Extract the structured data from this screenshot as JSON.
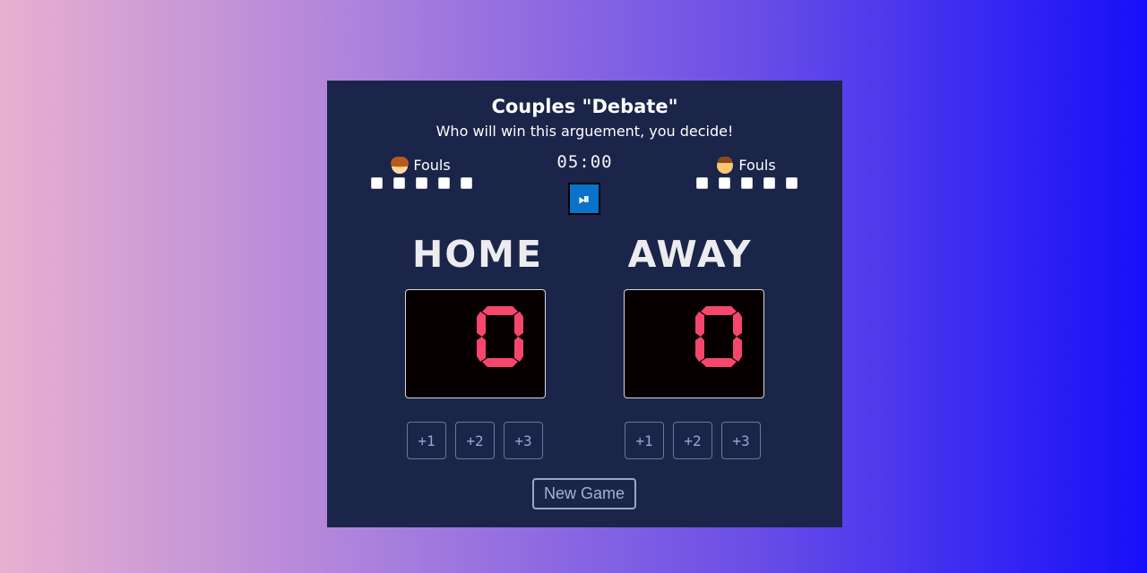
{
  "title": "Couples \"Debate\"",
  "subtitle": "Who will win this arguement, you decide!",
  "timer": "05:00",
  "play_pause_label": "⏯",
  "home": {
    "fouls_label": "Fouls",
    "avatar_icon": "woman-emoji-icon",
    "fouls": [
      false,
      false,
      false,
      false,
      false
    ],
    "name": "HOME",
    "score": "0",
    "buttons": [
      "+1",
      "+2",
      "+3"
    ]
  },
  "away": {
    "fouls_label": "Fouls",
    "avatar_icon": "man-emoji-icon",
    "fouls": [
      false,
      false,
      false,
      false,
      false
    ],
    "name": "AWAY",
    "score": "0",
    "buttons": [
      "+1",
      "+2",
      "+3"
    ]
  },
  "new_game_label": "New Game",
  "colors": {
    "board": "#1b2449",
    "score_digit": "#f4476b",
    "play_button": "#0a72c9"
  }
}
